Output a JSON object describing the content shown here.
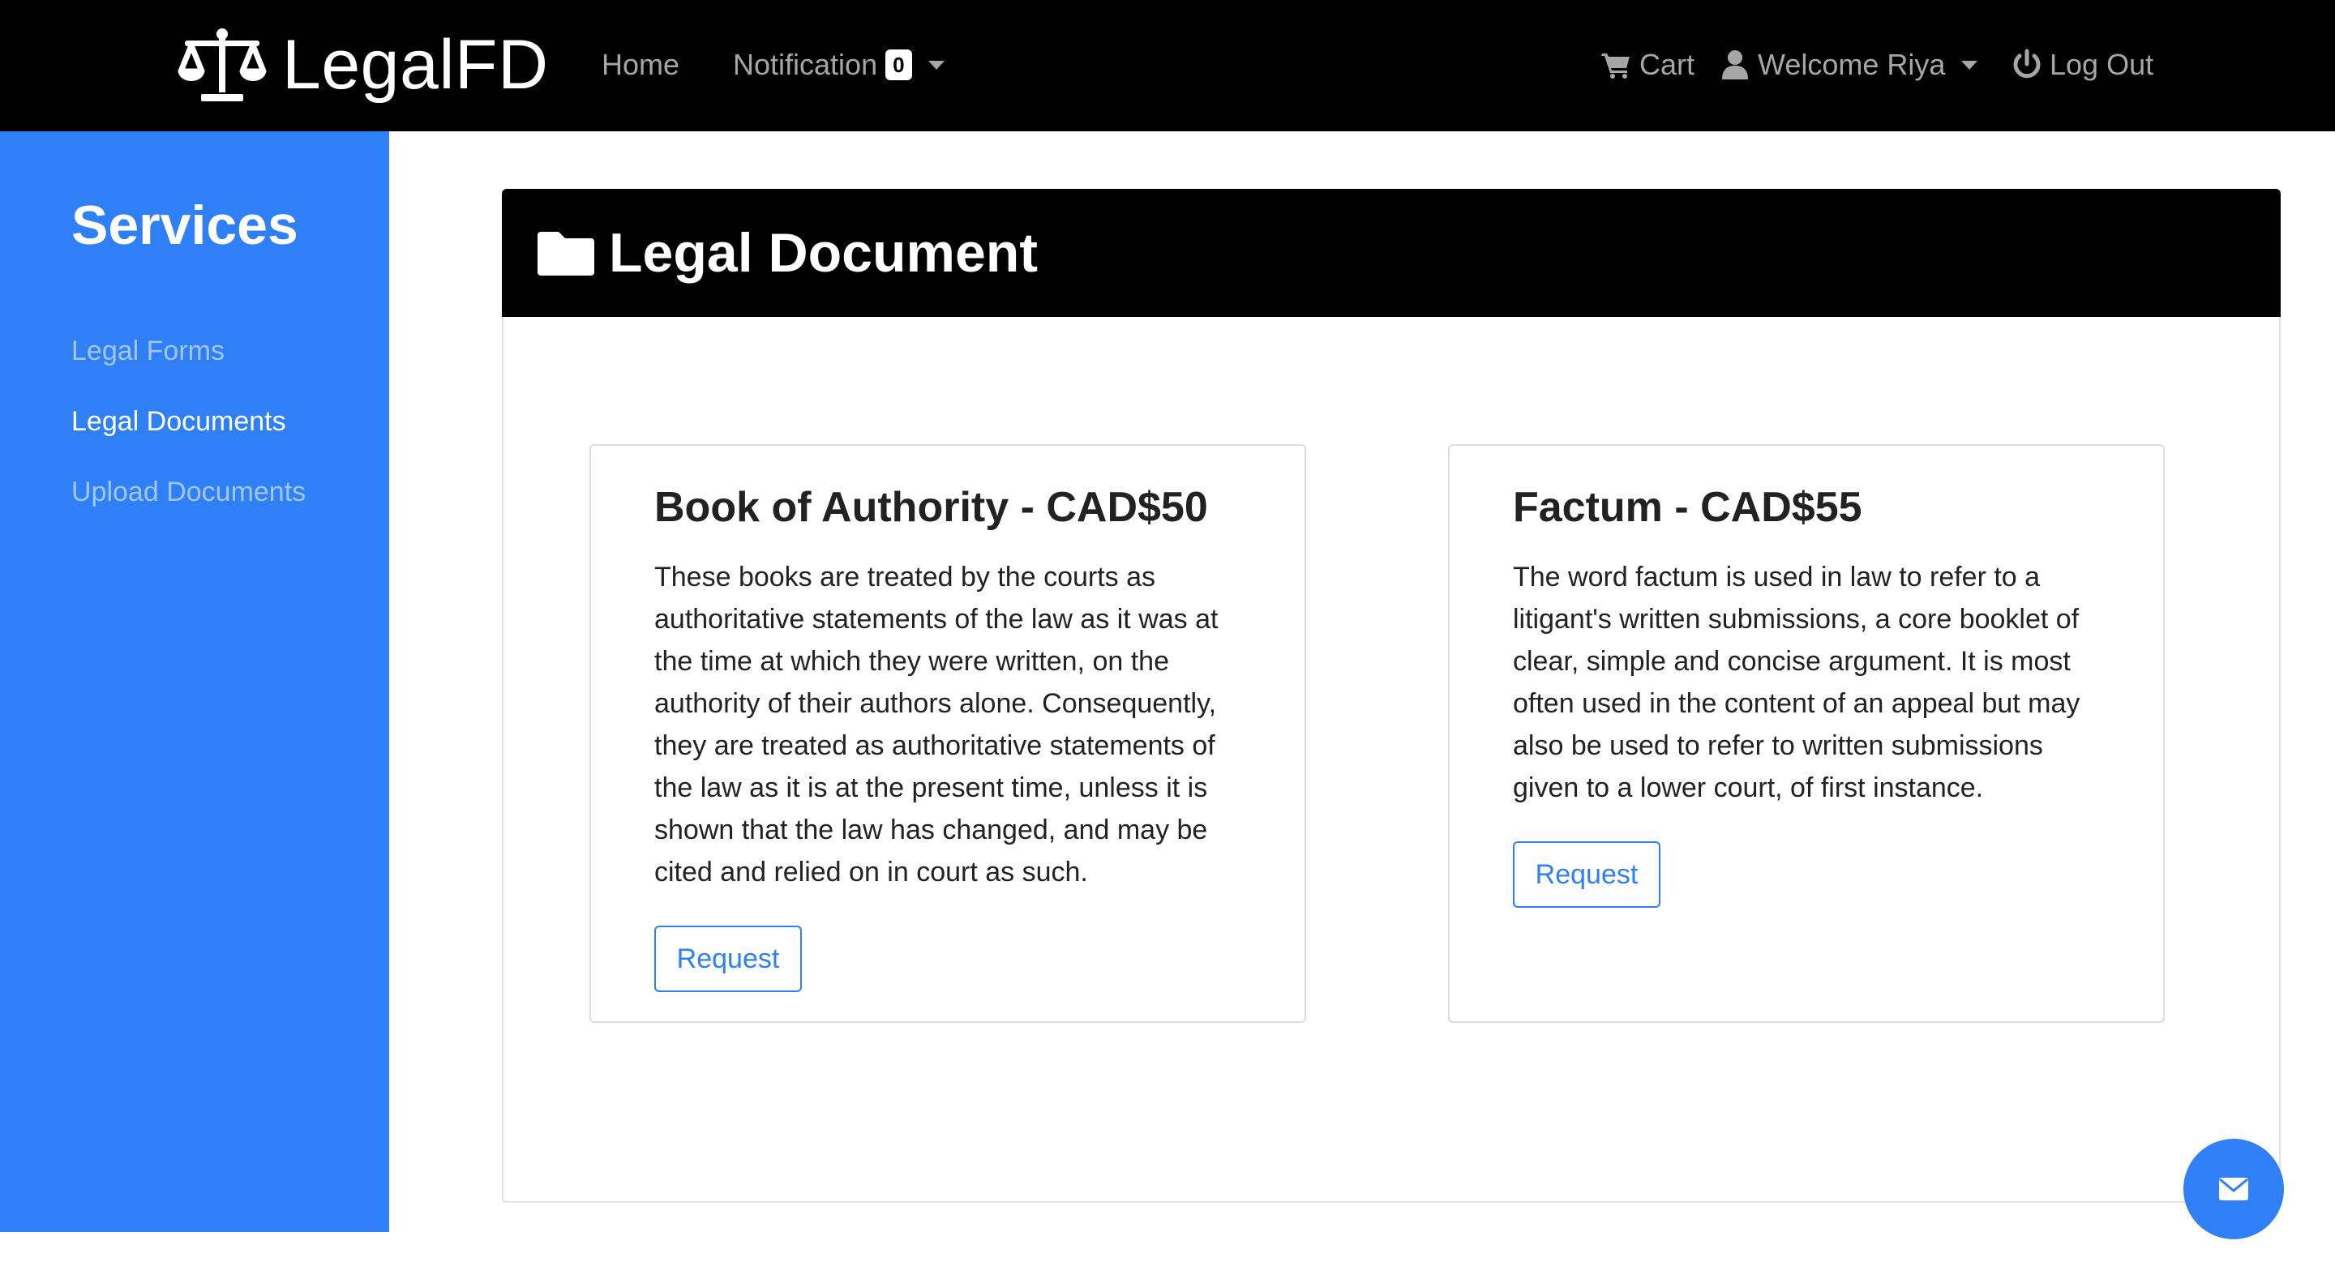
{
  "brand": {
    "name": "LegalFD",
    "icon": "scale-icon"
  },
  "nav": {
    "home": "Home",
    "notification": "Notification",
    "notification_count": "0",
    "cart": "Cart",
    "welcome": "Welcome Riya",
    "logout": "Log Out"
  },
  "sidebar": {
    "title": "Services",
    "items": [
      {
        "label": "Legal Forms",
        "active": false
      },
      {
        "label": "Legal Documents",
        "active": true
      },
      {
        "label": "Upload Documents",
        "active": false
      }
    ]
  },
  "main": {
    "title": "Legal Document",
    "icon": "folder-icon",
    "cards": [
      {
        "title": "Book of Authority - CAD$50",
        "text": "These books are treated by the courts as authoritative statements of the law as it was at the time at which they were written, on the authority of their authors alone. Consequently, they are treated as authoritative statements of the law as it is at the present time, unless it is shown that the law has changed, and may be cited and relied on in court as such.",
        "button": "Request"
      },
      {
        "title": "Factum - CAD$55",
        "text": "The word factum is used in law to refer to a litigant's written submissions, a core booklet of clear, simple and concise argument. It is most often used in the content of an appeal but may also be used to refer to written submissions given to a lower court, of first instance.",
        "button": "Request"
      }
    ]
  },
  "fab": {
    "icon": "envelope-icon"
  },
  "colors": {
    "accent": "#2f80f7",
    "navbar": "#000000",
    "muted": "#a6a6a6"
  }
}
